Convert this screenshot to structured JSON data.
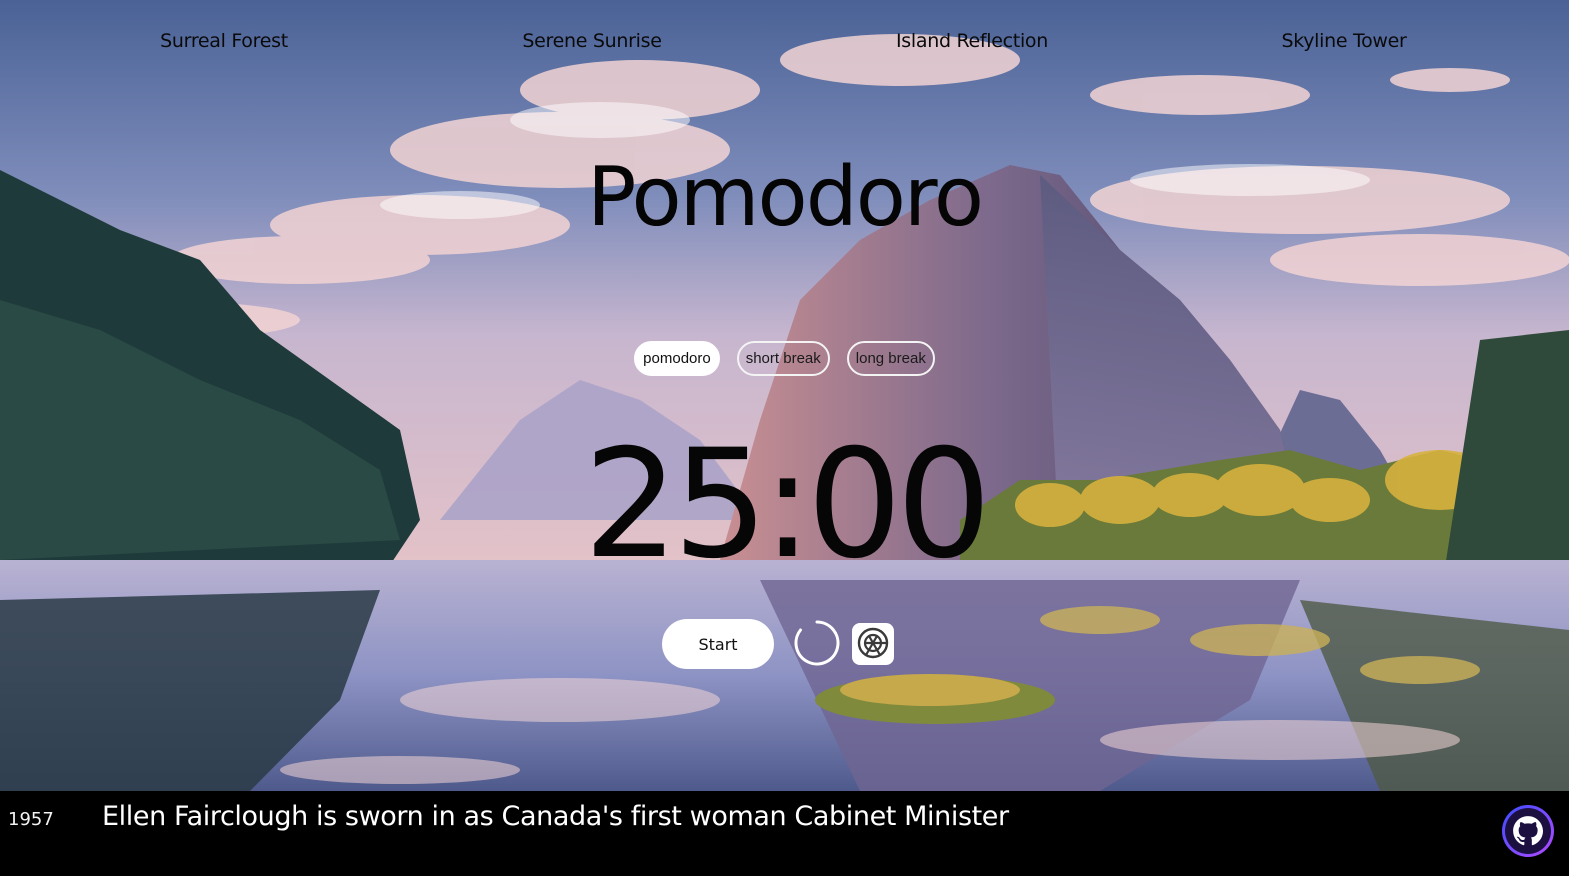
{
  "nav": {
    "links": [
      "Surreal Forest",
      "Serene Sunrise",
      "Island Reflection",
      "Skyline Tower"
    ]
  },
  "title": "Pomodoro",
  "modes": {
    "items": [
      "pomodoro",
      "short break",
      "long break"
    ],
    "active": "pomodoro"
  },
  "timer": "25:00",
  "controls": {
    "start_label": "Start",
    "reset_icon": "reset-icon",
    "settings_icon": "settings-icon"
  },
  "footer": {
    "year": "1957",
    "fact": "Ellen Fairclough is sworn in as Canada's first woman Cabinet Minister",
    "github_icon": "github-icon"
  },
  "colors": {
    "footer_bg": "#000000",
    "button_bg": "#ffffff",
    "github_gradient": [
      "#3b4cff",
      "#b44bff"
    ]
  }
}
